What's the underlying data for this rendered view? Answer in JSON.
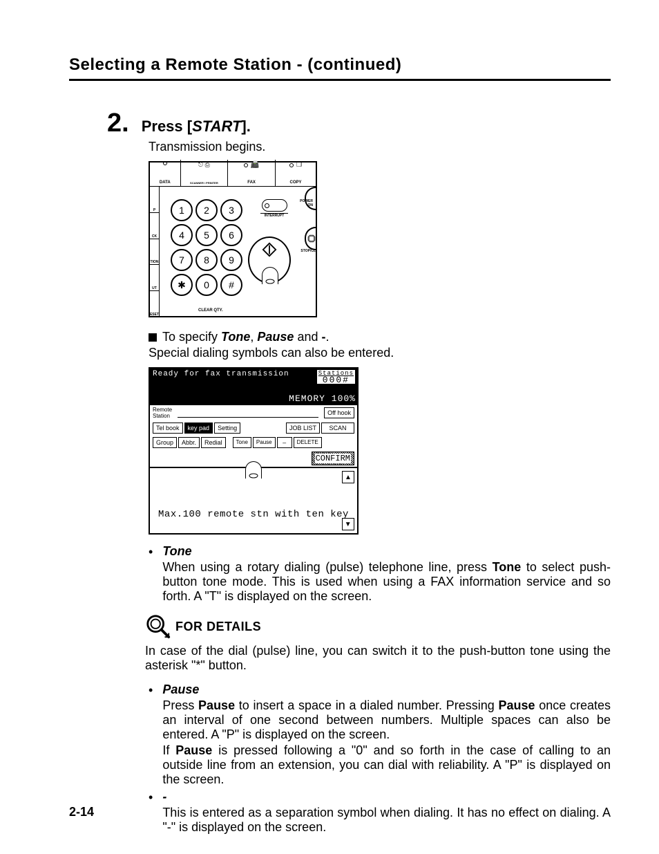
{
  "header": {
    "title": "Selecting a Remote Station -  (continued)"
  },
  "step": {
    "number": "2.",
    "instruction_prefix": "Press [",
    "instruction_word": "Start",
    "instruction_suffix": "].",
    "sub": "Transmission begins."
  },
  "keypad": {
    "top": {
      "data": "DATA",
      "scanner": "SCANNER / PRINTER",
      "fax": "FAX",
      "copy": "COPY"
    },
    "left_tabs": [
      "P",
      "CK",
      "TION",
      "UT",
      "ESET"
    ],
    "keys": [
      "1",
      "2",
      "3",
      "4",
      "5",
      "6",
      "7",
      "8",
      "9",
      "✱",
      "0",
      "#"
    ],
    "clear": "CLEAR QTY.",
    "interrupt": "INTERRUPT",
    "power": "POWER\nON",
    "stop": "STOP/CL"
  },
  "spec": {
    "line_prefix": "To specify ",
    "tone": "Tone",
    "comma": ", ",
    "pause": "Pause",
    "and": " and ",
    "dash": "-",
    "period": ".",
    "sub": "Special dialing symbols can also be entered."
  },
  "lcd": {
    "ready": "Ready for fax transmission",
    "stations_label": "Stations",
    "stations_count": "000#",
    "memory": "MEMORY 100%",
    "remote_label": "Remote\nStation",
    "offhook": "Off hook",
    "telbook": "Tel book",
    "keypad": "key pad",
    "setting": "Setting",
    "joblist": "JOB LIST",
    "scan": "SCAN",
    "group": "Group",
    "abbr": "Abbr.",
    "redial": "Redial",
    "tone": "Tone",
    "pause": "Pause",
    "dash": "–",
    "delete": "DELETE",
    "confirm": "CONFIRM",
    "maxmsg": "Max.100 remote stn with ten key"
  },
  "bullets": {
    "tone": {
      "label": "Tone",
      "body_1": "When using a rotary dialing (pulse) telephone line, press ",
      "body_bold": "Tone",
      "body_2": " to select push-button tone mode. This is used when using a FAX information service and so forth. A \"T\" is displayed on the screen."
    },
    "pause": {
      "label": "Pause",
      "p1_a": "Press ",
      "p1_b": "Pause",
      "p1_c": " to insert a space in a dialed number. Pressing ",
      "p1_d": "Pause",
      "p1_e": " once creates an interval of one second between numbers. Multiple spaces can also be entered. A \"P\" is displayed on the screen.",
      "p2_a": "If ",
      "p2_b": "Pause",
      "p2_c": " is pressed following a \"0\" and so forth in the case of calling to an outside line from an extension, you can dial with reliability. A \"P\" is displayed on the screen."
    },
    "dash": {
      "label": "-",
      "body": "This is entered as a separation symbol when dialing. It has no effect on dialing. A \"-\" is displayed on the screen."
    }
  },
  "details": {
    "heading": "FOR DETAILS",
    "text": "In case of the dial (pulse) line, you can switch it to the push-button tone using the asterisk \"*\" button."
  },
  "page_number": "2-14"
}
